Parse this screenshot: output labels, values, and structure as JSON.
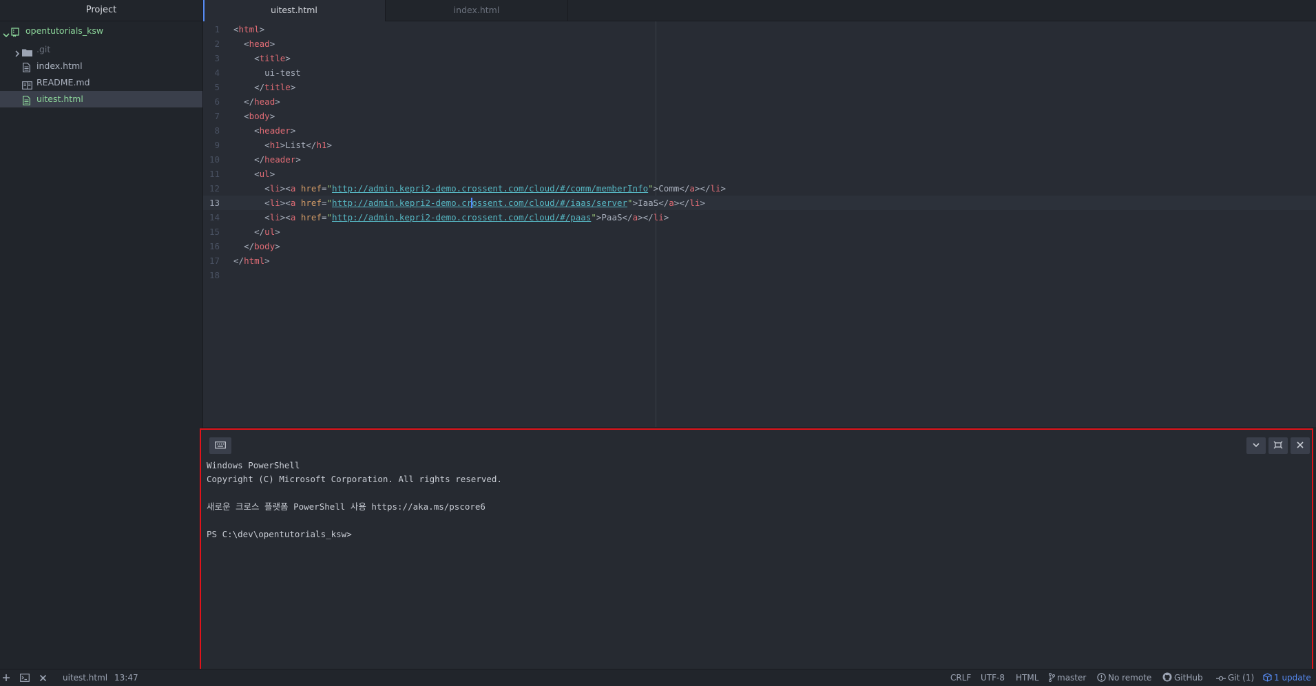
{
  "sidebar": {
    "title": "Project",
    "root": "opentutorials_ksw",
    "items": [
      {
        "label": ".git",
        "icon": "folder-icon"
      },
      {
        "label": "index.html",
        "icon": "file-icon"
      },
      {
        "label": "README.md",
        "icon": "book-icon"
      },
      {
        "label": "uitest.html",
        "icon": "file-icon",
        "selected": true
      }
    ]
  },
  "tabs": [
    {
      "label": "uitest.html",
      "active": true
    },
    {
      "label": "index.html",
      "active": false
    }
  ],
  "editor": {
    "line_numbers": [
      "1",
      "2",
      "3",
      "4",
      "5",
      "6",
      "7",
      "8",
      "9",
      "10",
      "11",
      "12",
      "13",
      "14",
      "15",
      "16",
      "17",
      "18"
    ],
    "cursor_line": 13,
    "text": {
      "title_text": "ui-test",
      "h1_text": "List",
      "url1": "http://admin.kepri2-demo.crossent.com/cloud/#/comm/memberInfo",
      "link1": "Comm",
      "url2a": "http://admin.kepri2-demo.cr",
      "url2b": "ossent.com/cloud/#/iaas/server",
      "link2": "IaaS",
      "url3": "http://admin.kepri2-demo.crossent.com/cloud/#/paas",
      "link3": "PaaS"
    }
  },
  "terminal": {
    "lines": [
      "Windows PowerShell",
      "Copyright (C) Microsoft Corporation. All rights reserved.",
      "",
      "새로운 크로스 플랫폼 PowerShell 사용 https://aka.ms/pscore6",
      "",
      "PS C:\\dev\\opentutorials_ksw>"
    ]
  },
  "statusbar": {
    "file": "uitest.html",
    "cursor": "13:47",
    "line_ending": "CRLF",
    "encoding": "UTF-8",
    "grammar": "HTML",
    "branch": "master",
    "remote": "No remote",
    "github": "GitHub",
    "git": "Git (1)",
    "update": "1 update"
  },
  "colors": {
    "accent": "#568af2",
    "highlight_border": "#e0131a"
  }
}
